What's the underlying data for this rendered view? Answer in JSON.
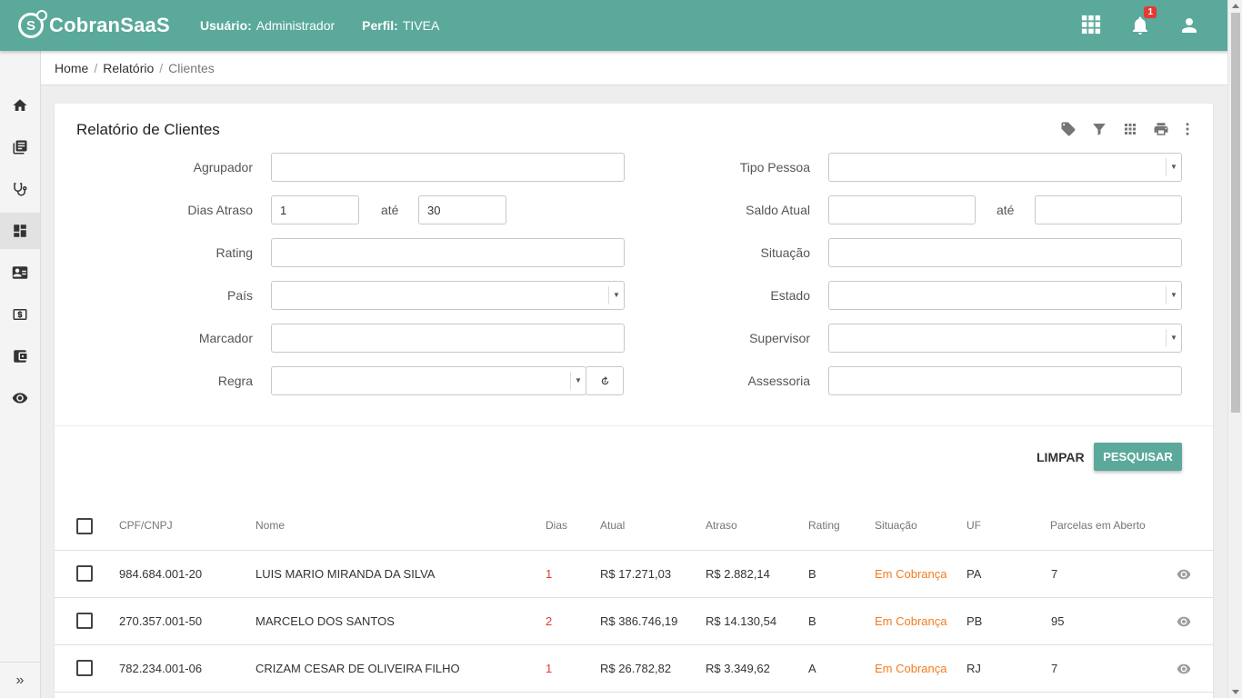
{
  "app": {
    "logo_text": "CobranSaaS",
    "user_label": "Usuário:",
    "user_value": "Administrador",
    "profile_label": "Perfil:",
    "profile_value": "TIVEA",
    "notification_count": "1",
    "brand_color": "#5aa99a"
  },
  "sidebar": {
    "items": [
      {
        "icon": "home-icon"
      },
      {
        "icon": "book-icon"
      },
      {
        "icon": "stethoscope-icon"
      },
      {
        "icon": "dashboard-icon",
        "active": true
      },
      {
        "icon": "contact-card-icon"
      },
      {
        "icon": "money-icon"
      },
      {
        "icon": "wallet-icon"
      },
      {
        "icon": "eye-icon"
      }
    ],
    "toggle_glyph": "»"
  },
  "breadcrumb": {
    "home": "Home",
    "sep": "/",
    "relatorio": "Relatório",
    "current": "Clientes"
  },
  "card": {
    "title": "Relatório de Clientes"
  },
  "filters": {
    "agrupador_label": "Agrupador",
    "dias_atraso_label": "Dias Atraso",
    "dias_from": "1",
    "dias_to": "30",
    "ate": "até",
    "rating_label": "Rating",
    "pais_label": "País",
    "marcador_label": "Marcador",
    "regra_label": "Regra",
    "tipo_pessoa_label": "Tipo Pessoa",
    "saldo_atual_label": "Saldo Atual",
    "situacao_label": "Situação",
    "estado_label": "Estado",
    "supervisor_label": "Supervisor",
    "assessoria_label": "Assessoria"
  },
  "actions": {
    "limpar": "LIMPAR",
    "pesquisar": "PESQUISAR"
  },
  "table": {
    "columns": [
      "CPF/CNPJ",
      "Nome",
      "Dias",
      "Atual",
      "Atraso",
      "Rating",
      "Situação",
      "UF",
      "Parcelas em Aberto"
    ],
    "rows": [
      {
        "cpf": "984.684.001-20",
        "nome": "LUIS MARIO MIRANDA DA SILVA",
        "dias": "1",
        "atual": "R$ 17.271,03",
        "atraso": "R$ 2.882,14",
        "rating": "B",
        "situacao": "Em Cobrança",
        "uf": "PA",
        "parcelas": "7"
      },
      {
        "cpf": "270.357.001-50",
        "nome": "MARCELO DOS SANTOS",
        "dias": "2",
        "atual": "R$ 386.746,19",
        "atraso": "R$ 14.130,54",
        "rating": "B",
        "situacao": "Em Cobrança",
        "uf": "PB",
        "parcelas": "95"
      },
      {
        "cpf": "782.234.001-06",
        "nome": "CRIZAM CESAR DE OLIVEIRA FILHO",
        "dias": "1",
        "atual": "R$ 26.782,82",
        "atraso": "R$ 3.349,62",
        "rating": "A",
        "situacao": "Em Cobrança",
        "uf": "RJ",
        "parcelas": "7"
      }
    ]
  }
}
